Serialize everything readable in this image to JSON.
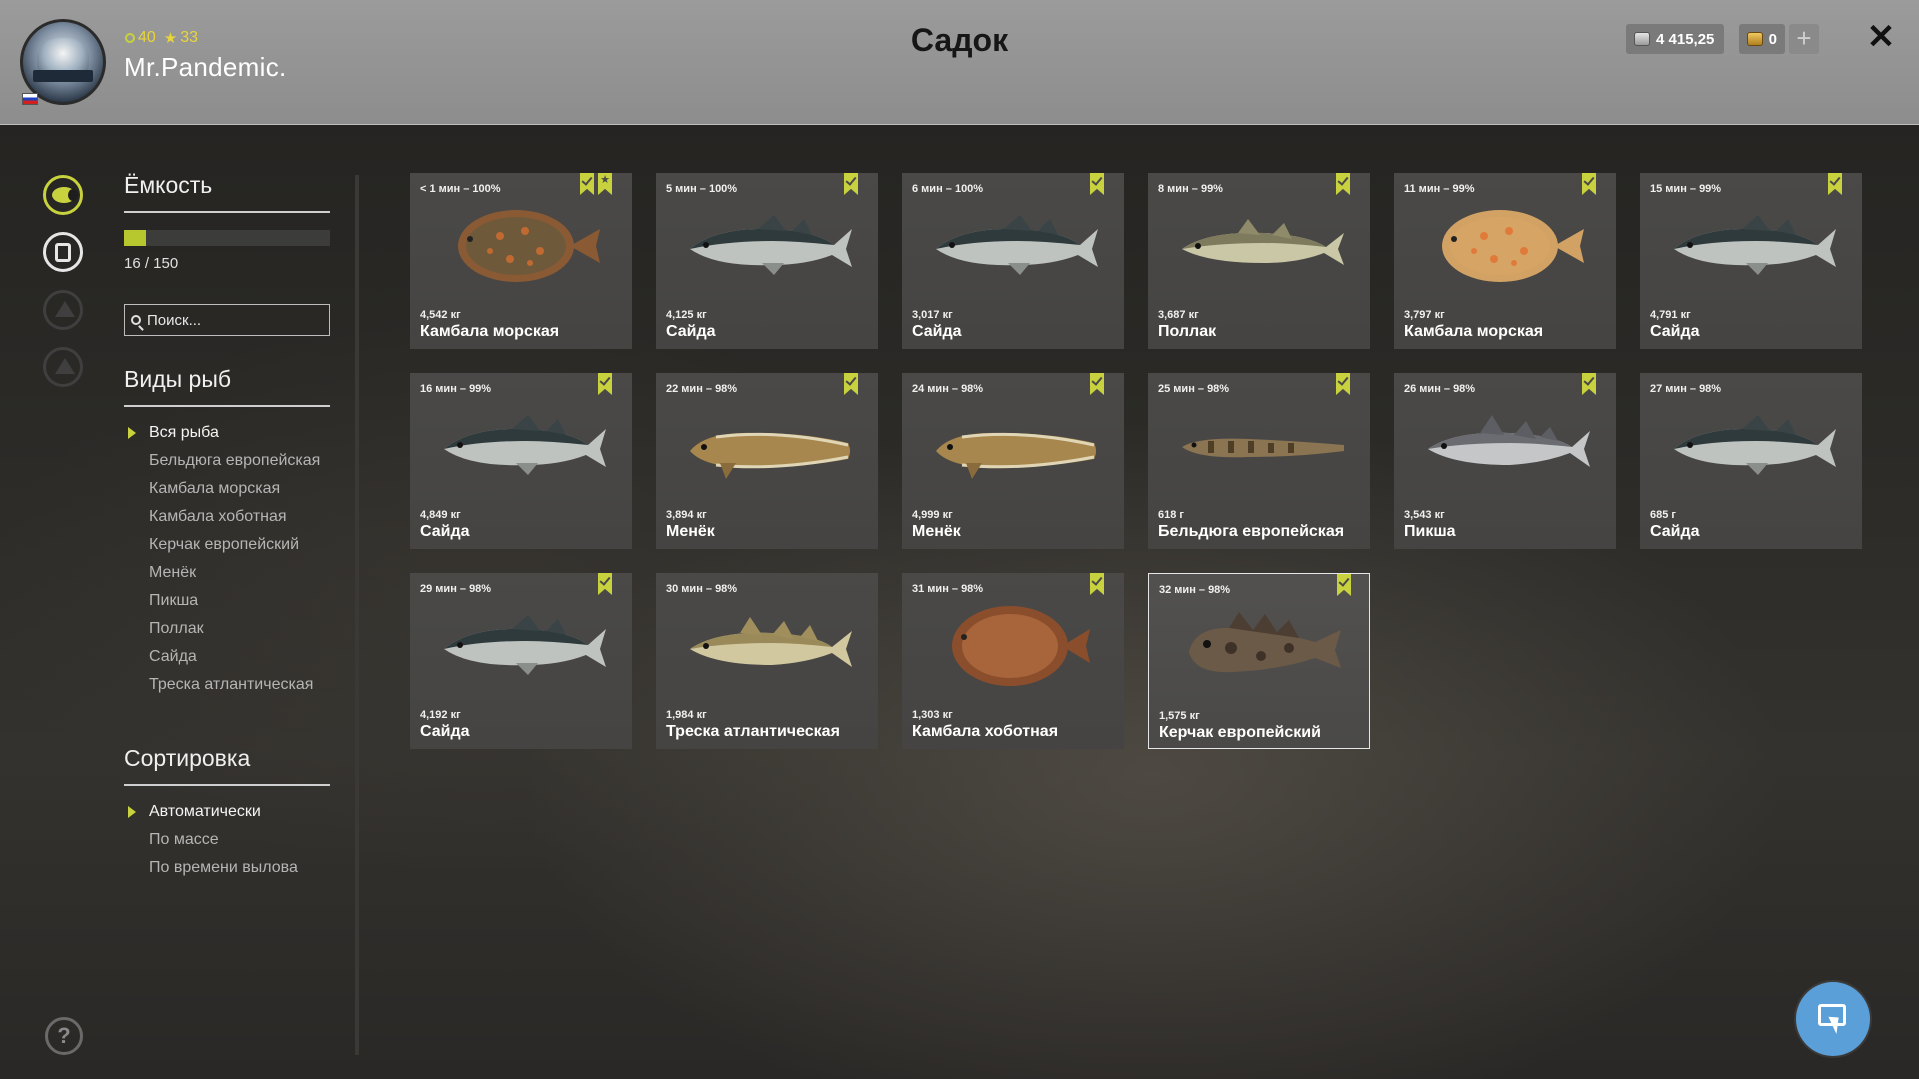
{
  "header": {
    "title": "Садок",
    "username": "Mr.Pandemic.",
    "level": "40",
    "rank": "33",
    "silver": "4 415,25",
    "gold": "0",
    "add_label": "+",
    "close_label": "✕"
  },
  "colors": {
    "accent": "#c7d23e",
    "card_bg": "#4a4947",
    "help_button": "#5a9fd8"
  },
  "rail": {
    "icons": [
      "fish-icon",
      "keepnet-icon",
      "boat-icon",
      "home-icon"
    ],
    "help_label": "?"
  },
  "capacity": {
    "title": "Ёмкость",
    "used": 16,
    "max": 150,
    "text": "16 / 150",
    "fraction": 0.107
  },
  "search": {
    "placeholder": "Поиск..."
  },
  "species": {
    "title": "Виды рыб",
    "items": [
      "Вся рыба",
      "Бельдюга европейская",
      "Камбала морская",
      "Камбала хоботная",
      "Керчак европейский",
      "Менёк",
      "Пикша",
      "Поллак",
      "Сайда",
      "Треска атлантическая"
    ]
  },
  "sorting": {
    "title": "Сортировка",
    "items": [
      "Автоматически",
      "По массе",
      "По времени вылова"
    ]
  },
  "fish": [
    {
      "time": "< 1 мин – 100%",
      "weight": "4,542 кг",
      "name": "Камбала морская",
      "bookmark": true,
      "star": true
    },
    {
      "time": "5 мин – 100%",
      "weight": "4,125 кг",
      "name": "Сайда",
      "bookmark": true,
      "star": false
    },
    {
      "time": "6 мин – 100%",
      "weight": "3,017 кг",
      "name": "Сайда",
      "bookmark": true,
      "star": false
    },
    {
      "time": "8 мин – 99%",
      "weight": "3,687 кг",
      "name": "Поллак",
      "bookmark": true,
      "star": false
    },
    {
      "time": "11 мин – 99%",
      "weight": "3,797 кг",
      "name": "Камбала морская",
      "bookmark": true,
      "star": false
    },
    {
      "time": "15 мин – 99%",
      "weight": "4,791 кг",
      "name": "Сайда",
      "bookmark": true,
      "star": false
    },
    {
      "time": "16 мин – 99%",
      "weight": "4,849 кг",
      "name": "Сайда",
      "bookmark": true,
      "star": false
    },
    {
      "time": "22 мин – 98%",
      "weight": "3,894 кг",
      "name": "Менёк",
      "bookmark": true,
      "star": false
    },
    {
      "time": "24 мин – 98%",
      "weight": "4,999 кг",
      "name": "Менёк",
      "bookmark": true,
      "star": false
    },
    {
      "time": "25 мин – 98%",
      "weight": "618 г",
      "name": "Бельдюга европейская",
      "bookmark": true,
      "star": false
    },
    {
      "time": "26 мин – 98%",
      "weight": "3,543 кг",
      "name": "Пикша",
      "bookmark": true,
      "star": false
    },
    {
      "time": "27 мин – 98%",
      "weight": "685 г",
      "name": "Сайда",
      "bookmark": false,
      "star": false
    },
    {
      "time": "29 мин – 98%",
      "weight": "4,192 кг",
      "name": "Сайда",
      "bookmark": true,
      "star": false
    },
    {
      "time": "30 мин – 98%",
      "weight": "1,984 кг",
      "name": "Треска атлантическая",
      "bookmark": false,
      "star": false
    },
    {
      "time": "31 мин – 98%",
      "weight": "1,303 кг",
      "name": "Камбала хоботная",
      "bookmark": true,
      "star": false
    },
    {
      "time": "32 мин – 98%",
      "weight": "1,575 кг",
      "name": "Керчак европейский",
      "bookmark": true,
      "star": false,
      "selected": true
    }
  ]
}
